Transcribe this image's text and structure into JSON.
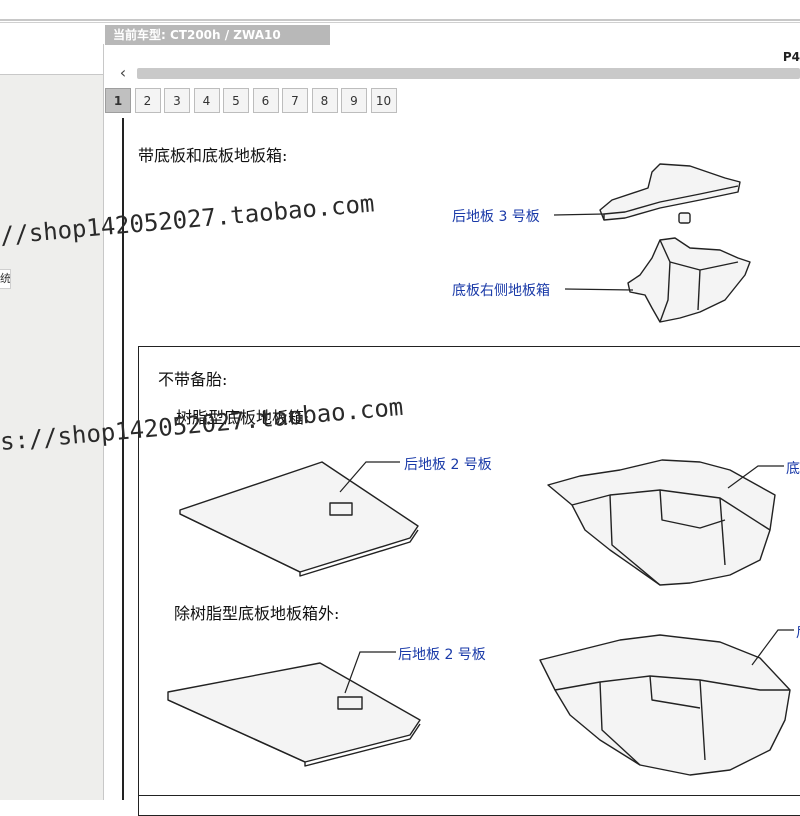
{
  "header": {
    "model_label": "当前车型: CT200h / ZWA10",
    "page_indicator": "P4"
  },
  "left_panel": {
    "partial_item": "统"
  },
  "pagination": {
    "pages": [
      "1",
      "2",
      "3",
      "4",
      "5",
      "6",
      "7",
      "8",
      "9",
      "10"
    ],
    "active": "1"
  },
  "sections": {
    "with_board_title": "带底板和底板地板箱:",
    "without_spare_title": "不带备胎:",
    "resin_title": "树脂型底板地板箱:",
    "non_resin_title": "除树脂型底板地板箱外:"
  },
  "callouts": {
    "rear_floor_board_3": "后地板 3 号板",
    "right_side_floor_box": "底板右侧地板箱",
    "rear_floor_board_2_a": "后地板 2 号板",
    "partial_right_a": "底",
    "rear_floor_board_2_b": "后地板 2 号板",
    "partial_right_b": "后"
  },
  "watermarks": {
    "wm1": "//shop142052027.taobao.com",
    "wm2": "s://shop142052027.taobao.com"
  },
  "icons": {
    "scroll_left": "chevron-left-icon"
  }
}
